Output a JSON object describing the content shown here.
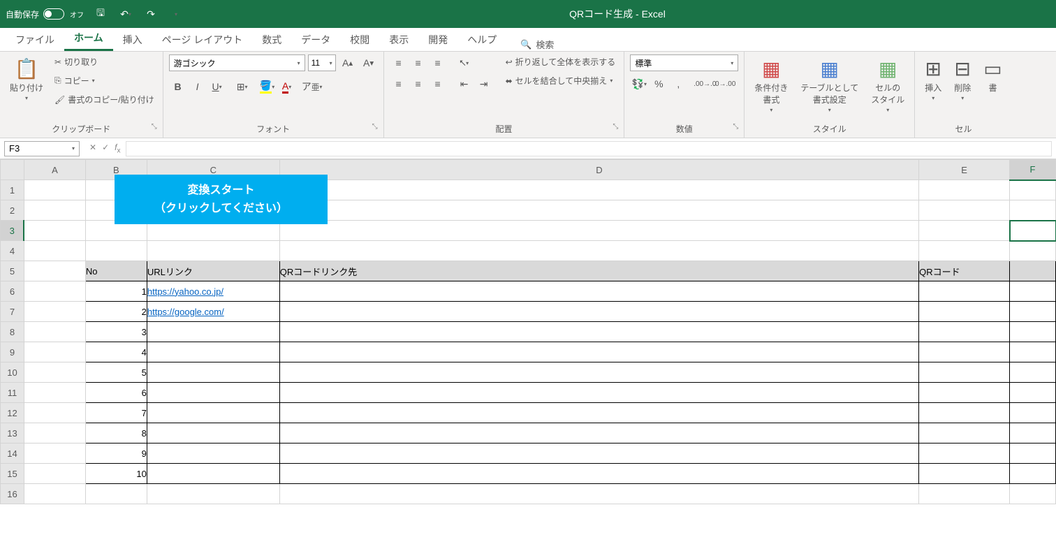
{
  "title_bar": {
    "autosave_label": "自動保存",
    "autosave_state": "オフ",
    "app_title": "QRコード生成  -  Excel"
  },
  "tabs": {
    "file": "ファイル",
    "home": "ホーム",
    "insert": "挿入",
    "page_layout": "ページ レイアウト",
    "formulas": "数式",
    "data": "データ",
    "review": "校閲",
    "view": "表示",
    "developer": "開発",
    "help": "ヘルプ",
    "search": "検索"
  },
  "ribbon": {
    "clipboard": {
      "paste": "貼り付け",
      "cut": "切り取り",
      "copy": "コピー",
      "format_painter": "書式のコピー/貼り付け",
      "label": "クリップボード"
    },
    "font": {
      "name": "游ゴシック",
      "size": "11",
      "label": "フォント"
    },
    "alignment": {
      "wrap": "折り返して全体を表示する",
      "merge": "セルを結合して中央揃え",
      "label": "配置"
    },
    "number": {
      "format": "標準",
      "label": "数値"
    },
    "styles": {
      "conditional": "条件付き\n書式",
      "table": "テーブルとして\n書式設定",
      "cell": "セルの\nスタイル",
      "label": "スタイル"
    },
    "cells": {
      "insert": "挿入",
      "delete": "削除",
      "format": "書",
      "label": "セル"
    }
  },
  "formula_bar": {
    "name_box": "F3"
  },
  "columns": [
    "A",
    "B",
    "C",
    "D",
    "E",
    "F"
  ],
  "macro_button": {
    "line1": "変換スタート",
    "line2": "（クリックしてください）"
  },
  "table": {
    "headers": {
      "no": "No",
      "url": "URLリンク",
      "qr_link": "QRコードリンク先",
      "qr_code": "QRコード"
    },
    "rows": [
      {
        "no": "1",
        "url": "https://yahoo.co.jp/"
      },
      {
        "no": "2",
        "url": "https://google.com/"
      },
      {
        "no": "3",
        "url": ""
      },
      {
        "no": "4",
        "url": ""
      },
      {
        "no": "5",
        "url": ""
      },
      {
        "no": "6",
        "url": ""
      },
      {
        "no": "7",
        "url": ""
      },
      {
        "no": "8",
        "url": ""
      },
      {
        "no": "9",
        "url": ""
      },
      {
        "no": "10",
        "url": ""
      }
    ]
  },
  "selected_cell": "F3"
}
